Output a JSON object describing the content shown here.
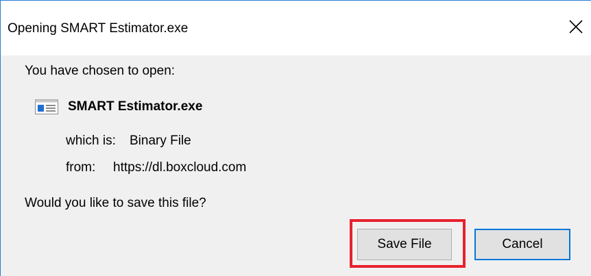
{
  "window": {
    "title": "Opening SMART Estimator.exe",
    "close_glyph": "✕"
  },
  "content": {
    "chosen_label": "You have chosen to open:",
    "file_name": "SMART Estimator.exe",
    "file_icon": "executable-file-icon",
    "which_is_label": "which is:",
    "which_is_value": "Binary File",
    "from_label": "from:",
    "from_value": "https://dl.boxcloud.com",
    "question": "Would you like to save this file?"
  },
  "buttons": {
    "save_label": "Save File",
    "cancel_label": "Cancel"
  },
  "colors": {
    "window_border": "#2b79d7",
    "body_background": "#f0f0f0",
    "highlight": "#e8202d",
    "default_button_border": "#0078d7"
  }
}
